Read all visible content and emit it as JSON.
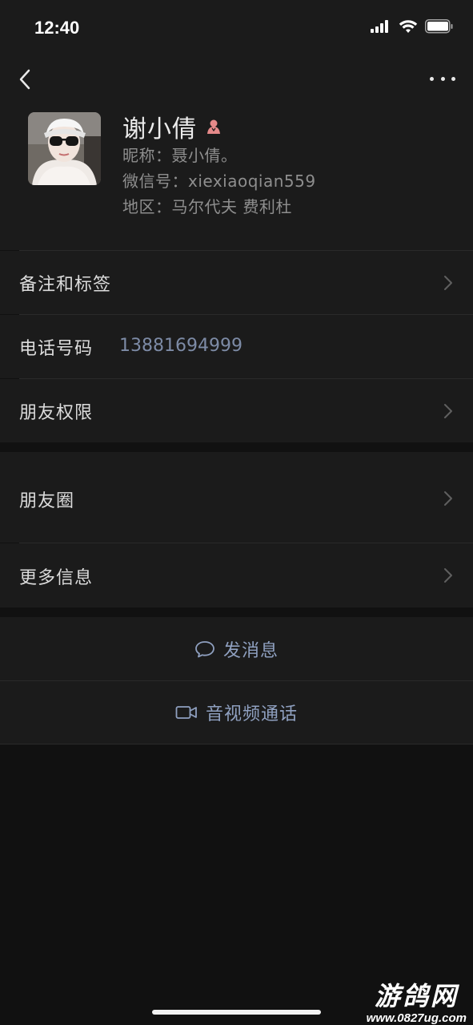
{
  "status_bar": {
    "time": "12:40"
  },
  "profile": {
    "name": "谢小倩",
    "nickname_label": "昵称：",
    "nickname_value": "聂小倩。",
    "wechat_id_label": "微信号：",
    "wechat_id_value": "xiexiaoqian559",
    "region_label": "地区：",
    "region_value": "马尔代夫 费利杜"
  },
  "rows": {
    "remarks": "备注和标签",
    "phone_label": "电话号码",
    "phone_value": "13881694999",
    "permissions": "朋友权限",
    "moments": "朋友圈",
    "more_info": "更多信息"
  },
  "actions": {
    "message": "发消息",
    "call": "音视频通话"
  },
  "watermark": {
    "title": "游鸽网",
    "url": "www.0827ug.com"
  },
  "colors": {
    "background": "#111111",
    "panel": "#1b1b1b",
    "link": "#8fa0c0",
    "phone": "#7d8ba6"
  }
}
